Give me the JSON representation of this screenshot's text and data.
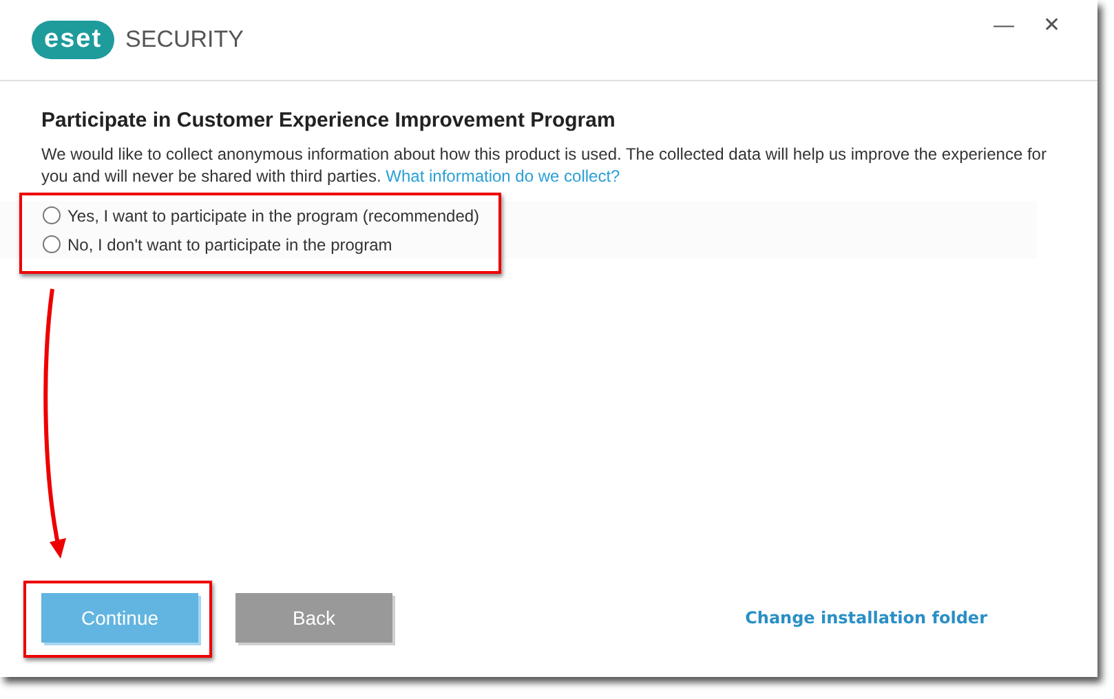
{
  "window": {
    "logo": "eset",
    "product": "SECURITY",
    "minimize": "—",
    "close": "✕"
  },
  "title": "Participate in Customer Experience Improvement Program",
  "description": "We would like to collect anonymous information about how this product is used. The collected data will help us improve the experience for you and will never be shared with third parties.",
  "info_link": "What information do we collect?",
  "options": [
    {
      "label": "Yes, I want to participate in the program (recommended)",
      "selected": false
    },
    {
      "label": "No, I don't want to participate in the program",
      "selected": false
    }
  ],
  "buttons": [
    {
      "label": "Continue",
      "kind": "primary"
    },
    {
      "label": "Back",
      "kind": "secondary"
    }
  ],
  "folder_link": "Change installation folder"
}
